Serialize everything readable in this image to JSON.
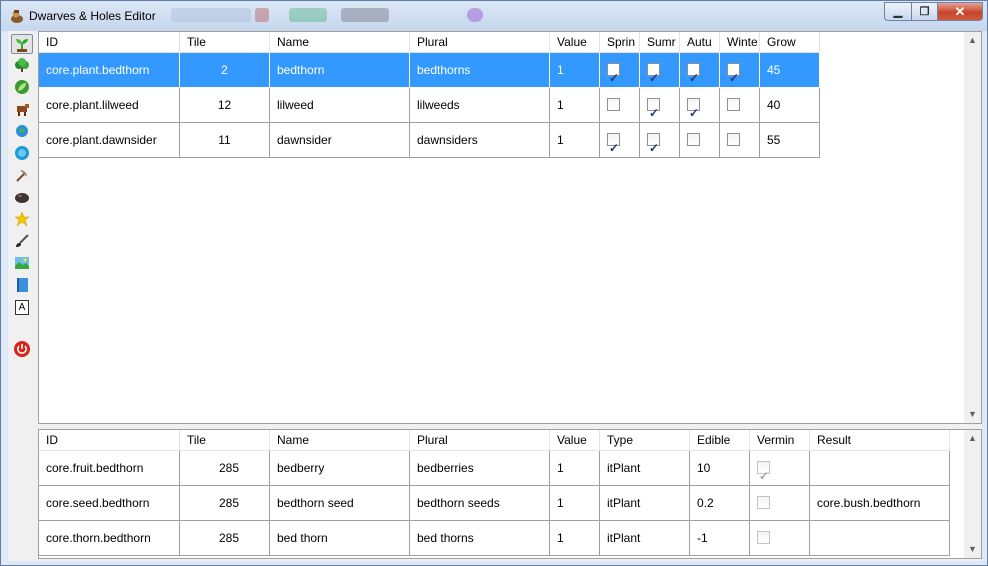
{
  "window": {
    "title": "Dwarves & Holes Editor"
  },
  "toolbar": {
    "items": [
      {
        "name": "plant-tool",
        "icon": "sprout-icon",
        "active": true
      },
      {
        "name": "bush-tool",
        "icon": "bush-icon"
      },
      {
        "name": "leaf-tool",
        "icon": "leaf-icon"
      },
      {
        "name": "animal-tool",
        "icon": "cow-icon"
      },
      {
        "name": "globe-tool",
        "icon": "globe-icon"
      },
      {
        "name": "world-tool",
        "icon": "world-icon"
      },
      {
        "name": "pickaxe-tool",
        "icon": "pickaxe-icon"
      },
      {
        "name": "rock-tool",
        "icon": "rock-icon"
      },
      {
        "name": "star-tool",
        "icon": "star-icon"
      },
      {
        "name": "brush-tool",
        "icon": "brush-icon"
      },
      {
        "name": "landscape-tool",
        "icon": "landscape-icon"
      },
      {
        "name": "book-tool",
        "icon": "book-icon"
      },
      {
        "name": "text-tool",
        "icon": "text-a-icon",
        "glyph": "A"
      },
      {
        "name": "exit-tool",
        "icon": "power-icon"
      }
    ]
  },
  "plants": {
    "columns": [
      "ID",
      "Tile",
      "Name",
      "Plural",
      "Value",
      "Sprin",
      "Sumr",
      "Autu",
      "Winte",
      "Grow"
    ],
    "rows": [
      {
        "id": "core.plant.bedthorn",
        "tile": "2",
        "name": "bedthorn",
        "plural": "bedthorns",
        "value": "1",
        "spring": true,
        "summer": true,
        "autumn": true,
        "winter": true,
        "grow": "45",
        "selected": true
      },
      {
        "id": "core.plant.lilweed",
        "tile": "12",
        "name": "lilweed",
        "plural": "lilweeds",
        "value": "1",
        "spring": false,
        "summer": true,
        "autumn": true,
        "winter": false,
        "grow": "40"
      },
      {
        "id": "core.plant.dawnsider",
        "tile": "11",
        "name": "dawnsider",
        "plural": "dawnsiders",
        "value": "1",
        "spring": true,
        "summer": true,
        "autumn": false,
        "winter": false,
        "grow": "55"
      }
    ]
  },
  "items": {
    "columns": [
      "ID",
      "Tile",
      "Name",
      "Plural",
      "Value",
      "Type",
      "Edible",
      "Vermin",
      "Result"
    ],
    "rows": [
      {
        "id": "core.fruit.bedthorn",
        "tile": "285",
        "name": "bedberry",
        "plural": "bedberries",
        "value": "1",
        "type": "itPlant",
        "edible": "10",
        "vermin": true,
        "result": ""
      },
      {
        "id": "core.seed.bedthorn",
        "tile": "285",
        "name": "bedthorn seed",
        "plural": "bedthorn seeds",
        "value": "1",
        "type": "itPlant",
        "edible": "0.2",
        "vermin": false,
        "result": "core.bush.bedthorn"
      },
      {
        "id": "core.thorn.bedthorn",
        "tile": "285",
        "name": "bed thorn",
        "plural": "bed thorns",
        "value": "1",
        "type": "itPlant",
        "edible": "-1",
        "vermin": false,
        "result": ""
      }
    ]
  },
  "colors": {
    "selection": "#3399ff",
    "grid": "#a0a0a0",
    "close": "#c7442a"
  }
}
